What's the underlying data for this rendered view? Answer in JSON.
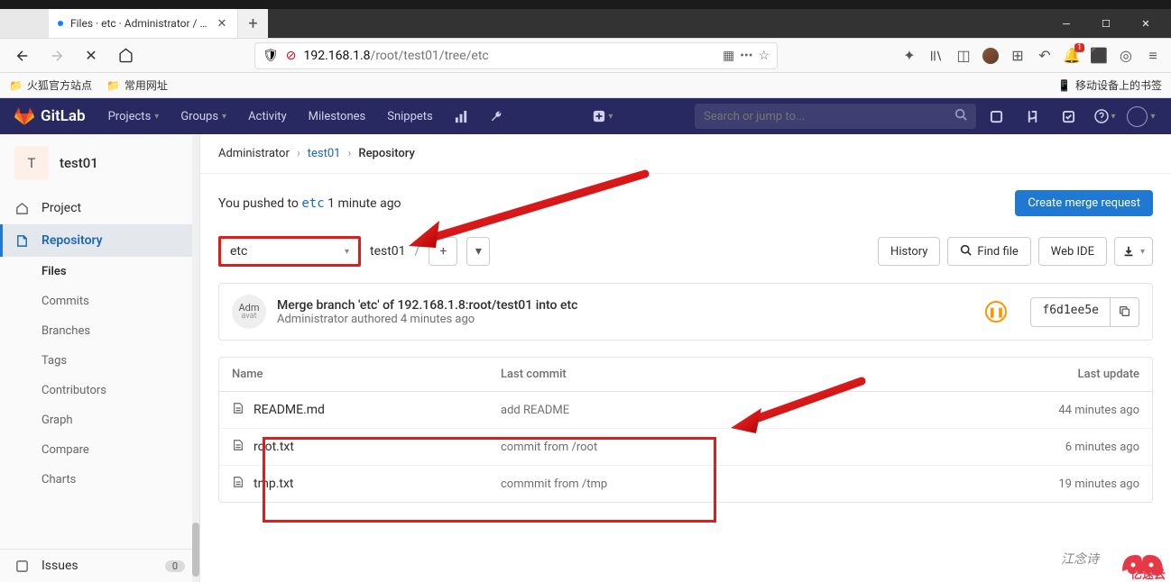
{
  "browser": {
    "top_hint": "",
    "tab_title": "Files · etc · Administrator / te",
    "url_prefix": "192.168.1.8",
    "url_path": "/root/test01/tree/etc",
    "bookmarks": {
      "b1": "火狐官方站点",
      "b2": "常用网址",
      "right": "移动设备上的书签"
    }
  },
  "gitlab_header": {
    "brand": "GitLab",
    "nav": {
      "projects": "Projects",
      "groups": "Groups",
      "activity": "Activity",
      "milestones": "Milestones",
      "snippets": "Snippets"
    },
    "search_placeholder": "Search or jump to..."
  },
  "sidebar": {
    "project_initial": "T",
    "project_name": "test01",
    "items": {
      "project": "Project",
      "repository": "Repository",
      "subs": {
        "files": "Files",
        "commits": "Commits",
        "branches": "Branches",
        "tags": "Tags",
        "contributors": "Contributors",
        "graph": "Graph",
        "compare": "Compare",
        "charts": "Charts"
      },
      "issues": "Issues",
      "issues_count": "0"
    }
  },
  "breadcrumb": {
    "l1": "Administrator",
    "l2": "test01",
    "l3": "Repository"
  },
  "push_notice": {
    "prefix": "You pushed to ",
    "branch": "etc",
    "suffix": " 1 minute ago",
    "button": "Create merge request"
  },
  "tree": {
    "branch": "etc",
    "path_repo": "test01",
    "path_sep": "/",
    "tools": {
      "history": "History",
      "find": "Find file",
      "ide": "Web IDE"
    }
  },
  "commit": {
    "avatar_top": "Adm",
    "avatar_bot": "avat",
    "title": "Merge branch 'etc' of 192.168.1.8:root/test01 into etc",
    "author": "Administrator",
    "verb": " authored ",
    "time": "4 minutes ago",
    "sha": "f6d1ee5e"
  },
  "table": {
    "headers": {
      "name": "Name",
      "commit": "Last commit",
      "update": "Last update"
    },
    "rows": [
      {
        "name": "README.md",
        "commit": "add README",
        "update": "44 minutes ago"
      },
      {
        "name": "root.txt",
        "commit": "commit from /root",
        "update": "6 minutes ago"
      },
      {
        "name": "tmp.txt",
        "commit": "commmit from /tmp",
        "update": "19 minutes ago"
      }
    ]
  },
  "watermark": "江念诗",
  "watermark_brand": "亿速云"
}
